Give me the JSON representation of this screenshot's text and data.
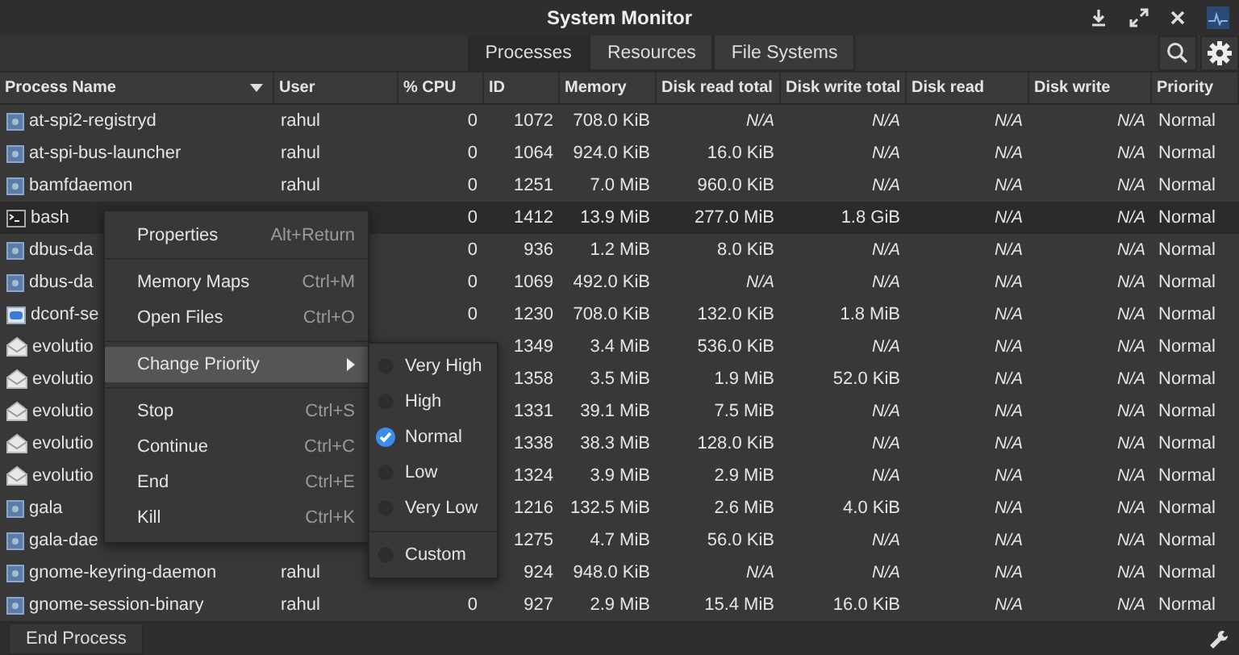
{
  "window": {
    "title": "System Monitor"
  },
  "tabs": [
    {
      "label": "Processes",
      "selected": true
    },
    {
      "label": "Resources",
      "selected": false
    },
    {
      "label": "File Systems",
      "selected": false
    }
  ],
  "table": {
    "columns": [
      {
        "label": "Process Name",
        "sorted": true
      },
      {
        "label": "User",
        "sorted": false
      },
      {
        "label": "% CPU",
        "sorted": false
      },
      {
        "label": "ID",
        "sorted": false
      },
      {
        "label": "Memory",
        "sorted": false
      },
      {
        "label": "Disk read total",
        "sorted": false
      },
      {
        "label": "Disk write total",
        "sorted": false
      },
      {
        "label": "Disk read",
        "sorted": false
      },
      {
        "label": "Disk write",
        "sorted": false
      },
      {
        "label": "Priority",
        "sorted": false
      }
    ],
    "rows": [
      {
        "kind": "service",
        "selected": false,
        "cells": [
          "at-spi2-registryd",
          "rahul",
          "0",
          "1072",
          "708.0 KiB",
          {
            "text": "N/A",
            "unavailable": true
          },
          {
            "text": "N/A",
            "unavailable": true
          },
          {
            "text": "N/A",
            "unavailable": true
          },
          {
            "text": "N/A",
            "unavailable": true
          },
          "Normal"
        ]
      },
      {
        "kind": "service",
        "selected": false,
        "cells": [
          "at-spi-bus-launcher",
          "rahul",
          "0",
          "1064",
          "924.0 KiB",
          "16.0 KiB",
          {
            "text": "N/A",
            "unavailable": true
          },
          {
            "text": "N/A",
            "unavailable": true
          },
          {
            "text": "N/A",
            "unavailable": true
          },
          "Normal"
        ]
      },
      {
        "kind": "service",
        "selected": false,
        "cells": [
          "bamfdaemon",
          "rahul",
          "0",
          "1251",
          "7.0 MiB",
          "960.0 KiB",
          {
            "text": "N/A",
            "unavailable": true
          },
          {
            "text": "N/A",
            "unavailable": true
          },
          {
            "text": "N/A",
            "unavailable": true
          },
          "Normal"
        ]
      },
      {
        "kind": "terminal",
        "selected": true,
        "cells": [
          "bash",
          null,
          "0",
          "1412",
          "13.9 MiB",
          "277.0 MiB",
          "1.8 GiB",
          {
            "text": "N/A",
            "unavailable": true
          },
          {
            "text": "N/A",
            "unavailable": true
          },
          "Normal"
        ]
      },
      {
        "kind": "service",
        "selected": false,
        "cells": [
          "dbus-da",
          null,
          "0",
          "936",
          "1.2 MiB",
          "8.0 KiB",
          {
            "text": "N/A",
            "unavailable": true
          },
          {
            "text": "N/A",
            "unavailable": true
          },
          {
            "text": "N/A",
            "unavailable": true
          },
          "Normal"
        ]
      },
      {
        "kind": "service",
        "selected": false,
        "cells": [
          "dbus-da",
          null,
          "0",
          "1069",
          "492.0 KiB",
          {
            "text": "N/A",
            "unavailable": true
          },
          {
            "text": "N/A",
            "unavailable": true
          },
          {
            "text": "N/A",
            "unavailable": true
          },
          {
            "text": "N/A",
            "unavailable": true
          },
          "Normal"
        ]
      },
      {
        "kind": "config",
        "selected": false,
        "cells": [
          "dconf-se",
          null,
          "0",
          "1230",
          "708.0 KiB",
          "132.0 KiB",
          "1.8 MiB",
          {
            "text": "N/A",
            "unavailable": true
          },
          {
            "text": "N/A",
            "unavailable": true
          },
          "Normal"
        ]
      },
      {
        "kind": "mail",
        "selected": false,
        "cells": [
          "evolutio",
          null,
          null,
          "1349",
          "3.4 MiB",
          "536.0 KiB",
          {
            "text": "N/A",
            "unavailable": true
          },
          {
            "text": "N/A",
            "unavailable": true
          },
          {
            "text": "N/A",
            "unavailable": true
          },
          "Normal"
        ]
      },
      {
        "kind": "mail",
        "selected": false,
        "cells": [
          "evolutio",
          null,
          null,
          "1358",
          "3.5 MiB",
          "1.9 MiB",
          "52.0 KiB",
          {
            "text": "N/A",
            "unavailable": true
          },
          {
            "text": "N/A",
            "unavailable": true
          },
          "Normal"
        ]
      },
      {
        "kind": "mail",
        "selected": false,
        "cells": [
          "evolutio",
          null,
          null,
          "1331",
          "39.1 MiB",
          "7.5 MiB",
          {
            "text": "N/A",
            "unavailable": true
          },
          {
            "text": "N/A",
            "unavailable": true
          },
          {
            "text": "N/A",
            "unavailable": true
          },
          "Normal"
        ]
      },
      {
        "kind": "mail",
        "selected": false,
        "cells": [
          "evolutio",
          null,
          null,
          "1338",
          "38.3 MiB",
          "128.0 KiB",
          {
            "text": "N/A",
            "unavailable": true
          },
          {
            "text": "N/A",
            "unavailable": true
          },
          {
            "text": "N/A",
            "unavailable": true
          },
          "Normal"
        ]
      },
      {
        "kind": "mail",
        "selected": false,
        "cells": [
          "evolutio",
          null,
          null,
          "1324",
          "3.9 MiB",
          "2.9 MiB",
          {
            "text": "N/A",
            "unavailable": true
          },
          {
            "text": "N/A",
            "unavailable": true
          },
          {
            "text": "N/A",
            "unavailable": true
          },
          "Normal"
        ]
      },
      {
        "kind": "service",
        "selected": false,
        "cells": [
          "gala",
          null,
          null,
          "1216",
          "132.5 MiB",
          "2.6 MiB",
          "4.0 KiB",
          {
            "text": "N/A",
            "unavailable": true
          },
          {
            "text": "N/A",
            "unavailable": true
          },
          "Normal"
        ]
      },
      {
        "kind": "service",
        "selected": false,
        "cells": [
          "gala-dae",
          null,
          null,
          "1275",
          "4.7 MiB",
          "56.0 KiB",
          {
            "text": "N/A",
            "unavailable": true
          },
          {
            "text": "N/A",
            "unavailable": true
          },
          {
            "text": "N/A",
            "unavailable": true
          },
          "Normal"
        ]
      },
      {
        "kind": "service",
        "selected": false,
        "cells": [
          "gnome-keyring-daemon",
          "rahul",
          null,
          "924",
          "948.0 KiB",
          {
            "text": "N/A",
            "unavailable": true
          },
          {
            "text": "N/A",
            "unavailable": true
          },
          {
            "text": "N/A",
            "unavailable": true
          },
          {
            "text": "N/A",
            "unavailable": true
          },
          "Normal"
        ]
      },
      {
        "kind": "service",
        "selected": false,
        "cells": [
          "gnome-session-binary",
          "rahul",
          "0",
          "927",
          "2.9 MiB",
          "15.4 MiB",
          "16.0 KiB",
          {
            "text": "N/A",
            "unavailable": true
          },
          {
            "text": "N/A",
            "unavailable": true
          },
          "Normal"
        ]
      }
    ]
  },
  "context_menu": {
    "items": [
      {
        "kind": "item",
        "label": "Properties",
        "shortcut": "Alt+Return"
      },
      {
        "kind": "separator"
      },
      {
        "kind": "item",
        "label": "Memory Maps",
        "shortcut": "Ctrl+M"
      },
      {
        "kind": "item",
        "label": "Open Files",
        "shortcut": "Ctrl+O"
      },
      {
        "kind": "separator"
      },
      {
        "kind": "submenu",
        "label": "Change Priority",
        "selected": true
      },
      {
        "kind": "separator"
      },
      {
        "kind": "item",
        "label": "Stop",
        "shortcut": "Ctrl+S"
      },
      {
        "kind": "item",
        "label": "Continue",
        "shortcut": "Ctrl+C"
      },
      {
        "kind": "item",
        "label": "End",
        "shortcut": "Ctrl+E"
      },
      {
        "kind": "item",
        "label": "Kill",
        "shortcut": "Ctrl+K"
      }
    ]
  },
  "priority_submenu": {
    "items": [
      {
        "kind": "radio",
        "label": "Very High",
        "selected": false
      },
      {
        "kind": "radio",
        "label": "High",
        "selected": false
      },
      {
        "kind": "radio",
        "label": "Normal",
        "selected": true
      },
      {
        "kind": "radio",
        "label": "Low",
        "selected": false
      },
      {
        "kind": "radio",
        "label": "Very Low",
        "selected": false
      },
      {
        "kind": "separator"
      },
      {
        "kind": "radio",
        "label": "Custom",
        "selected": false
      }
    ]
  },
  "status_bar": {
    "button": "End Process"
  }
}
